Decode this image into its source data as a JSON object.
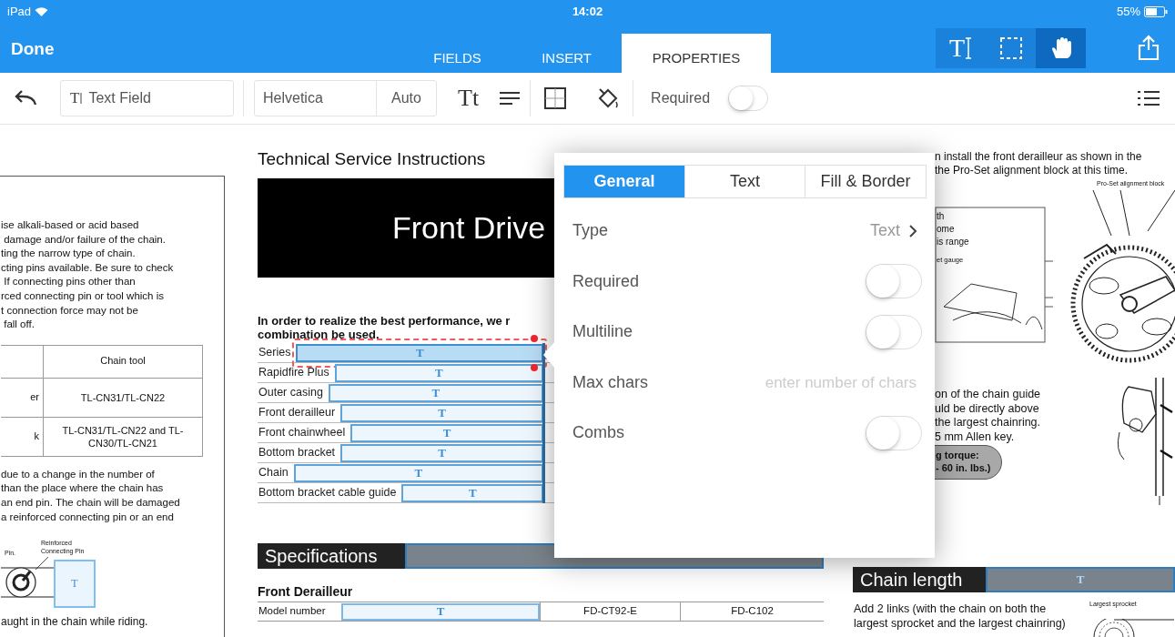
{
  "status_bar": {
    "device": "iPad",
    "time": "14:02",
    "battery": "55%"
  },
  "nav": {
    "done": "Done",
    "tabs": [
      {
        "label": "FIELDS",
        "selected": false
      },
      {
        "label": "INSERT",
        "selected": false
      },
      {
        "label": "PROPERTIES",
        "selected": true
      }
    ],
    "modes": [
      {
        "kind": "text",
        "glyph": "T",
        "selected": false
      },
      {
        "kind": "select",
        "selected": false
      },
      {
        "kind": "hand",
        "selected": true
      }
    ]
  },
  "toolbar": {
    "field_glyph": "T",
    "field_type": "Text Field",
    "font": "Helvetica",
    "size": "Auto",
    "style_glyph": "Tt",
    "required_label": "Required",
    "required_on": false
  },
  "left_page": {
    "top_lines": [
      "ise alkali-based or acid based",
      " damage and/or failure of the chain.",
      "ting the narrow type of chain.",
      "cting pins available. Be sure to check",
      " If connecting pins other than",
      "rced connecting pin or tool which is",
      "t connection force may not be",
      " fall off."
    ],
    "table": {
      "column_2_header": "Chain tool",
      "rows": [
        {
          "column_1": "er",
          "column_2": "TL-CN31/TL-CN22"
        },
        {
          "column_1": "k",
          "column_2": "TL-CN31/TL-CN22 and TL-CN30/TL-CN21"
        }
      ]
    },
    "middle_lines": [
      "due to a change in the number of",
      "than the place where the chain has",
      "an end pin. The chain will be damaged",
      "a reinforced connecting pin or an end"
    ],
    "diagram_labels": [
      "Pin.",
      "Reinforced Connecting Pin"
    ],
    "diagram_field_glyph": "T",
    "bottom_line": "aught in the chain while riding."
  },
  "main_page": {
    "heading": "Technical Service Instructions",
    "banner": "Front Drive",
    "intro_lines": [
      "In order to realize the best performance, we r",
      "combination be used."
    ],
    "form_rows": [
      {
        "label": "Series",
        "glyph": "T",
        "selected": true
      },
      {
        "label": "Rapidfire Plus",
        "glyph": "T",
        "selected": false
      },
      {
        "label": "Outer casing",
        "glyph": "T",
        "selected": false
      },
      {
        "label": "Front derailleur",
        "glyph": "T",
        "selected": false
      },
      {
        "label": "Front chainwheel",
        "glyph": "T",
        "selected": false
      },
      {
        "label": "Bottom bracket",
        "glyph": "T",
        "selected": false
      },
      {
        "label": "Chain",
        "glyph": "T",
        "selected": false
      },
      {
        "label": "Bottom bracket cable guide",
        "glyph": "T",
        "selected": false
      }
    ],
    "section_title": "Specifications",
    "subheading": "Front Derailleur",
    "spec_row": {
      "label": "Model number",
      "glyph": "T",
      "column_2": "FD-CT92-E",
      "column_3": "FD-C102"
    }
  },
  "right_page": {
    "top_lines": [
      "n install the front derailleur as shown in the",
      "the Pro-Set alignment block at this time."
    ],
    "inset_labels": [
      "th",
      "ome",
      "is range"
    ],
    "gauge_label": "et gauge",
    "block_label": "Pro-Set alignment block",
    "guide_lines": [
      "on of the chain guide",
      "uld be directly above",
      "the largest chainring.",
      "5 mm Allen key."
    ],
    "torque_lines": [
      "g torque:",
      "- 60 in. lbs.)"
    ],
    "section_title": "Chain length",
    "section_glyph": "T",
    "chain_lines": [
      "Add 2 links (with the chain on both the",
      "largest sprocket and the largest chainring)"
    ],
    "sprocket_label": "Largest sprocket"
  },
  "popover": {
    "tabs": [
      {
        "label": "General",
        "selected": true
      },
      {
        "label": "Text",
        "selected": false
      },
      {
        "label": "Fill & Border",
        "selected": false
      }
    ],
    "rows": [
      {
        "kind": "link",
        "label": "Type",
        "value": "Text"
      },
      {
        "kind": "toggle",
        "label": "Required",
        "on": false
      },
      {
        "kind": "toggle",
        "label": "Multiline",
        "on": false
      },
      {
        "kind": "input",
        "label": "Max chars",
        "placeholder": "enter number of chars"
      },
      {
        "kind": "toggle",
        "label": "Combs",
        "on": false
      }
    ]
  }
}
